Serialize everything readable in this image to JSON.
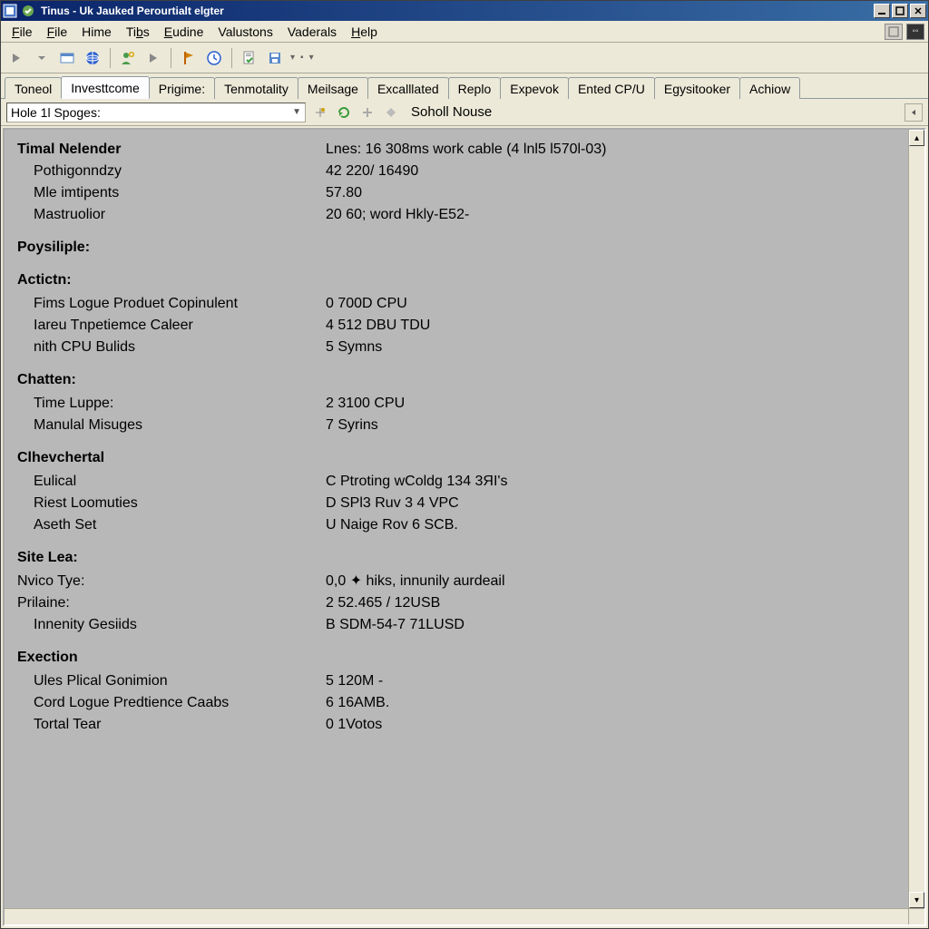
{
  "window": {
    "title": "Tinus - Uk Jauked Perourtialt elgter"
  },
  "menu": {
    "items": [
      {
        "label": "File",
        "u": 0
      },
      {
        "label": "File",
        "u": 0
      },
      {
        "label": "Hime",
        "u": -1
      },
      {
        "label": "Tibs",
        "u": 2
      },
      {
        "label": "Eudine",
        "u": 0
      },
      {
        "label": "Valustons",
        "u": -1
      },
      {
        "label": "Vaderals",
        "u": -1
      },
      {
        "label": "Help",
        "u": 0
      }
    ]
  },
  "tabs": [
    {
      "label": "Toneol",
      "active": false
    },
    {
      "label": "Investtcome",
      "active": true
    },
    {
      "label": "Prigime:",
      "active": false
    },
    {
      "label": "Tenmotality",
      "active": false
    },
    {
      "label": "Meilsage",
      "active": false
    },
    {
      "label": "Excalllated",
      "active": false
    },
    {
      "label": "Replo",
      "active": false
    },
    {
      "label": "Expevok",
      "active": false
    },
    {
      "label": "Ented CP/U",
      "active": false
    },
    {
      "label": "Egysitooker",
      "active": false
    },
    {
      "label": "Achiow",
      "active": false
    }
  ],
  "subbar": {
    "combo_label": "Hole 1l Spoges:",
    "status_label": "Soholl Nouse"
  },
  "report": {
    "group1": {
      "title": "Timal Nelender",
      "title_val": "Lnes: 16 308ms work cable (4 lnl5 l570l-03)",
      "rows": [
        {
          "lbl": "Pothigonndzy",
          "val": "42 220/ 16490"
        },
        {
          "lbl": "Mle imtipents",
          "val": "57.80"
        },
        {
          "lbl": "Mastruolior",
          "val": "20 60; word Hkly-E52-"
        }
      ]
    },
    "group2": {
      "title": "Poysiliple:"
    },
    "group3": {
      "title": "Actictn:",
      "rows": [
        {
          "lbl": "Fims Logue Produet Copinulent",
          "val": "0 700D CPU"
        },
        {
          "lbl": "Iareu Tnpetiemce Caleer",
          "val": "4 512 DBU TDU"
        },
        {
          "lbl": "nith CPU Bulids",
          "val": "5 Symns"
        }
      ]
    },
    "group4": {
      "title": "Chatten:",
      "rows": [
        {
          "lbl": "Time Luppe:",
          "val": "2 3100 CPU"
        },
        {
          "lbl": "Manulal Misuges",
          "val": "7 Syrins"
        }
      ]
    },
    "group5": {
      "title": "Clhevchertal",
      "rows": [
        {
          "lbl": "Eulical",
          "val": "C Ptroting wColdg 134 3ЯI's"
        },
        {
          "lbl": "Riest Loomuties",
          "val": "D SPl3 Ruv 3 4 VPC"
        },
        {
          "lbl": "Aseth Set",
          "val": "U Naige Rov 6 SCB."
        }
      ]
    },
    "group6": {
      "title": "Site Lea:",
      "tightrows": [
        {
          "lbl": "Nvico Tye:",
          "val": "0,0 ✦ hiks, innunily aurdeail"
        },
        {
          "lbl": "Prilaine:",
          "val": "2 52.465 / 12USB"
        }
      ],
      "rows": [
        {
          "lbl": "Innenity Gesiids",
          "val": "B SDM-54-7 71LUSD"
        }
      ]
    },
    "group7": {
      "title": "Exection",
      "rows": [
        {
          "lbl": "Ules Plical Gonimion",
          "val": "5 120M -"
        },
        {
          "lbl": "Cord Logue Predtience Caabs",
          "val": "6 16AMB."
        },
        {
          "lbl": "Tortal Tear",
          "val": "0 1Votos"
        }
      ]
    }
  }
}
